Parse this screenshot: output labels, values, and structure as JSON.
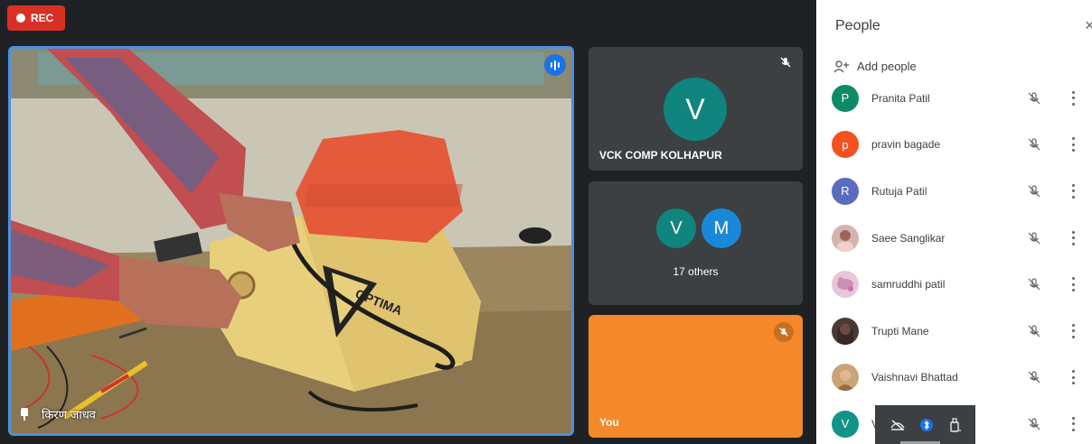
{
  "recording": {
    "label": "REC"
  },
  "main_tile": {
    "participant_name": "किरण जाधव",
    "video_text": "OPTIMA"
  },
  "side_tiles": {
    "speaker": {
      "avatar_letter": "V",
      "name": "VCK COMP KOLHAPUR",
      "avatar_color": "#10847e"
    },
    "group": {
      "avatars": [
        {
          "letter": "V",
          "color": "#10847e"
        },
        {
          "letter": "M",
          "color": "#1a88d8"
        }
      ],
      "label": "17 others"
    },
    "self": {
      "label": "You",
      "color": "#f5892a"
    }
  },
  "people_panel": {
    "title": "People",
    "close": "×",
    "add_people_label": "Add people",
    "participants": [
      {
        "name": "Pranita Patil",
        "initial": "P",
        "color": "#0e8a66"
      },
      {
        "name": "pravin bagade",
        "initial": "p",
        "color": "#f4511e"
      },
      {
        "name": "Rutuja Patil",
        "initial": "R",
        "color": "#5c6bc0"
      },
      {
        "name": "Saee Sanglikar",
        "initial": "",
        "color": "#d4b4b0"
      },
      {
        "name": "samruddhi patil",
        "initial": "",
        "color": "#e9c6d6"
      },
      {
        "name": "Trupti Mane",
        "initial": "",
        "color": "#4a3a36"
      },
      {
        "name": "Vaishnavi Bhattad",
        "initial": "",
        "color": "#c9a476"
      },
      {
        "name": "V",
        "initial": "V",
        "color": "#129488"
      }
    ]
  },
  "tray": {
    "icons": [
      "hide-icon",
      "bluetooth-icon",
      "usb-icon"
    ]
  }
}
